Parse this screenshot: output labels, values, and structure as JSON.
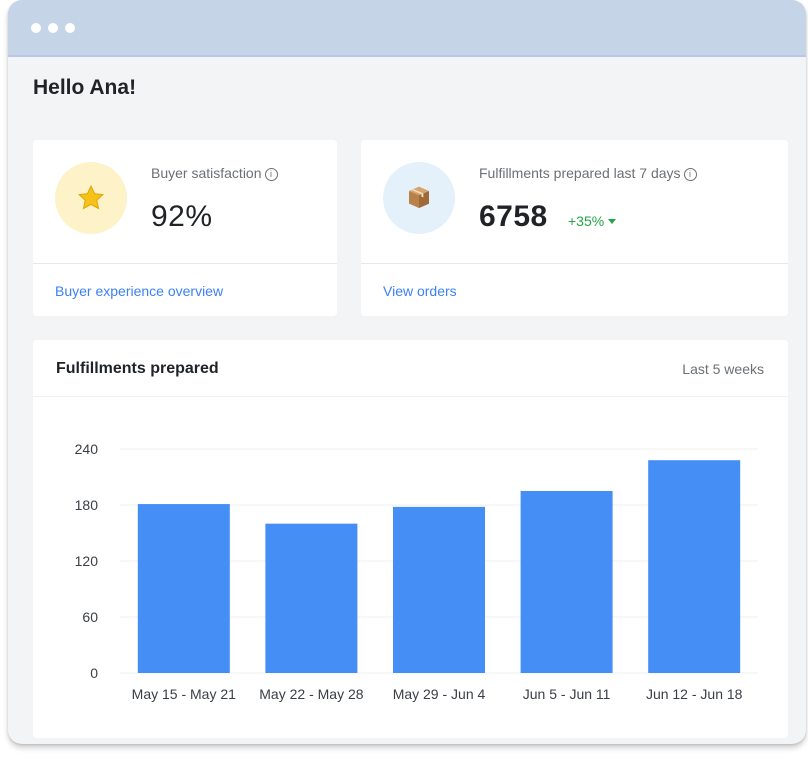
{
  "greeting": "Hello Ana!",
  "cards": [
    {
      "icon": "star-icon",
      "label": "Buyer satisfaction",
      "value": "92%",
      "link": "Buyer experience overview"
    },
    {
      "icon": "package-icon",
      "label": "Fulfillments prepared last 7 days",
      "value": "6758",
      "delta": "+35%",
      "link": "View orders"
    }
  ],
  "chart_panel": {
    "title": "Fulfillments prepared",
    "range": "Last 5 weeks"
  },
  "colors": {
    "bar": "#448ef6",
    "delta": "#22a447",
    "link": "#3b82f6",
    "titlebar": "#c6d4e8"
  },
  "chart_data": {
    "type": "bar",
    "categories": [
      "May 15 - May 21",
      "May 22 - May 28",
      "May 29 - Jun 4",
      "Jun 5 - Jun 11",
      "Jun 12 - Jun 18"
    ],
    "values": [
      181,
      160,
      178,
      195,
      228
    ],
    "ylim": [
      0,
      240
    ],
    "yticks": [
      0,
      60,
      120,
      180,
      240
    ],
    "grid": true,
    "xlabel": "",
    "ylabel": ""
  }
}
